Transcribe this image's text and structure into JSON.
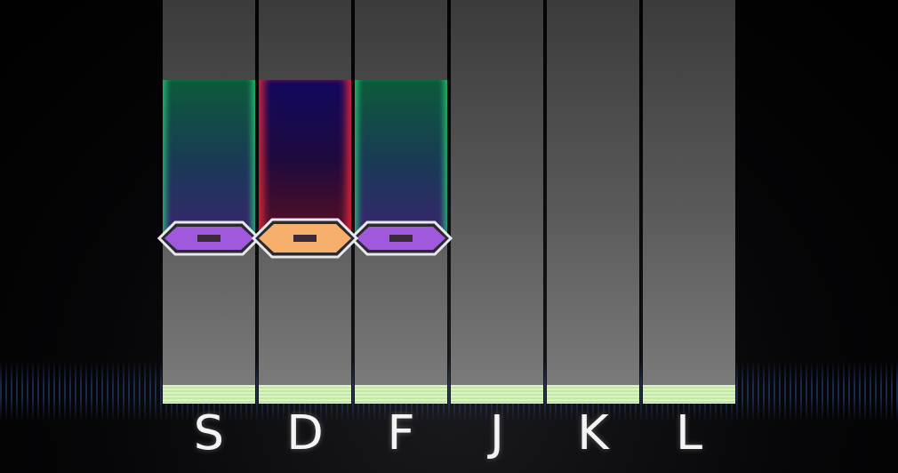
{
  "lanes": [
    {
      "key": "S",
      "note": {
        "kind": "side",
        "color": "#a059dc"
      }
    },
    {
      "key": "D",
      "note": {
        "kind": "center",
        "color": "#f7b06c"
      }
    },
    {
      "key": "F",
      "note": {
        "kind": "side",
        "color": "#a059dc"
      }
    },
    {
      "key": "J",
      "note": null
    },
    {
      "key": "K",
      "note": null
    },
    {
      "key": "L",
      "note": null
    }
  ]
}
